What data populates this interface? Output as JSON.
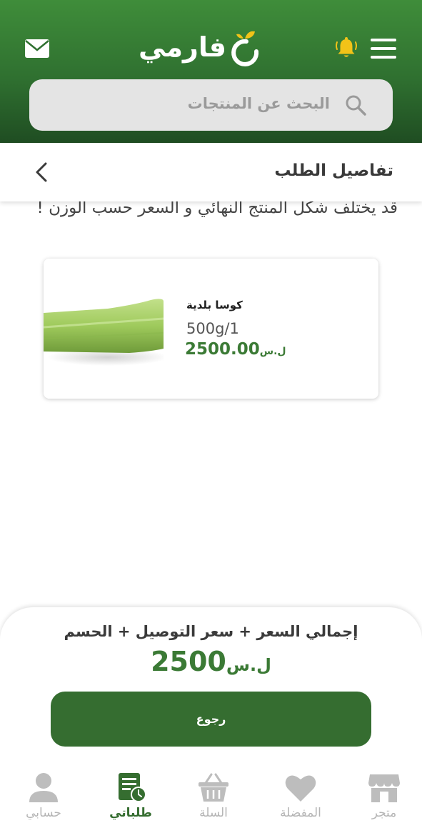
{
  "header": {
    "logo_text": "فارمي",
    "search_placeholder": "البحث عن المنتجات",
    "colors": {
      "header_green": "#2f7030",
      "accent_yellow": "#f2c318",
      "brand_green": "#356d30"
    }
  },
  "title_bar": {
    "title": "تفاصيل الطلب"
  },
  "notice": "قد يختلف شكل المنتج النهائي و السعر حسب الوزن !",
  "product": {
    "name": "كوسا بلدية",
    "quantity": "500g/1",
    "price": "2500.00",
    "currency": "ل.س"
  },
  "summary": {
    "label": "إجمالي السعر + سعر التوصيل + الحسم",
    "total": "2500",
    "currency": "ل.س",
    "button_label": "رجوع"
  },
  "nav": {
    "items": [
      {
        "label": "متجر",
        "icon": "store-icon"
      },
      {
        "label": "المفضلة",
        "icon": "heart-icon"
      },
      {
        "label": "السلة",
        "icon": "basket-icon"
      },
      {
        "label": "طلباتي",
        "icon": "orders-icon",
        "active": true
      },
      {
        "label": "حسابي",
        "icon": "user-icon"
      }
    ]
  }
}
